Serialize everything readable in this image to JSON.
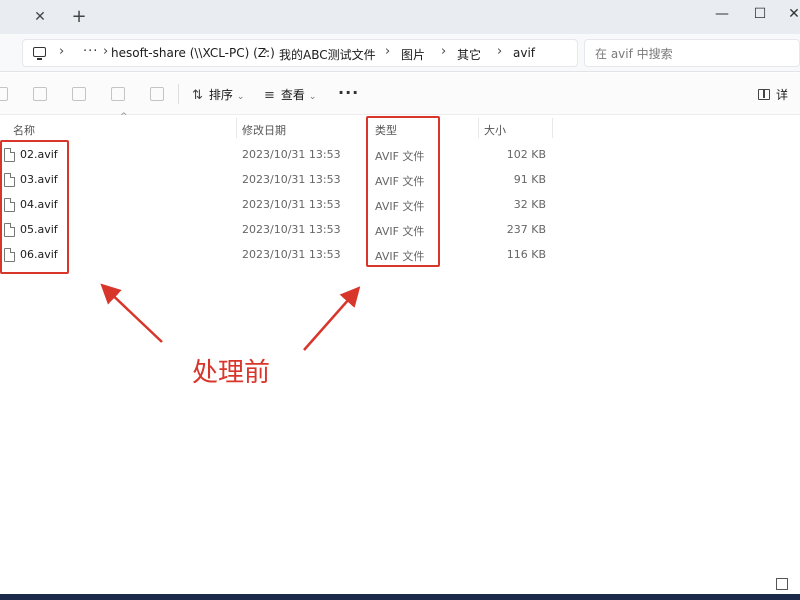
{
  "window": {
    "tab_close_glyph": "✕",
    "tab_add_glyph": "+",
    "minimize_glyph": "—",
    "maximize_glyph": "☐",
    "close_glyph": "✕"
  },
  "address": {
    "overflow": "···",
    "breadcrumbs": [
      "hesoft-share (\\\\XCL-PC) (Z:)",
      "我的ABC测试文件",
      "图片",
      "其它",
      "avif"
    ]
  },
  "search": {
    "placeholder": "在 avif 中搜索"
  },
  "toolbar": {
    "sort_label": "排序",
    "view_label": "查看",
    "more_glyph": "···",
    "details_label": "详"
  },
  "columns": {
    "name": "名称",
    "date": "修改日期",
    "type": "类型",
    "size": "大小"
  },
  "files": [
    {
      "name": "02.avif",
      "date": "2023/10/31 13:53",
      "type": "AVIF 文件",
      "size": "102 KB"
    },
    {
      "name": "03.avif",
      "date": "2023/10/31 13:53",
      "type": "AVIF 文件",
      "size": "91 KB"
    },
    {
      "name": "04.avif",
      "date": "2023/10/31 13:53",
      "type": "AVIF 文件",
      "size": "32 KB"
    },
    {
      "name": "05.avif",
      "date": "2023/10/31 13:53",
      "type": "AVIF 文件",
      "size": "237 KB"
    },
    {
      "name": "06.avif",
      "date": "2023/10/31 13:53",
      "type": "AVIF 文件",
      "size": "116 KB"
    }
  ],
  "annotation": {
    "text": "处理前",
    "color": "#d8362b"
  }
}
